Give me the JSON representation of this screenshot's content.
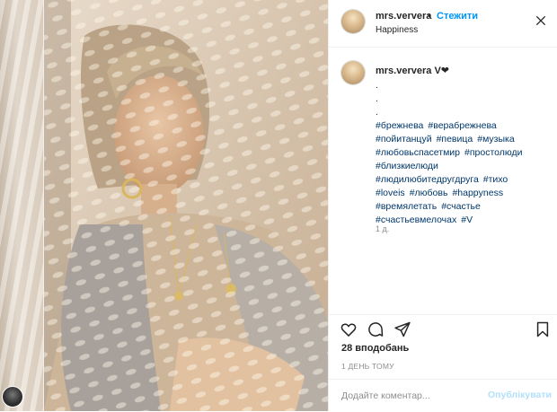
{
  "header": {
    "username": "mrs.ververa",
    "separator": "•",
    "follow_label": "Стежити",
    "location": "Happiness"
  },
  "caption": {
    "username": "mrs.ververa",
    "username_suffix": " V❤",
    "dots": [
      ".",
      ".",
      "."
    ],
    "hashtags": [
      "#брежнева",
      "#верабрежнева",
      "#пойитанцуй",
      "#певица",
      "#музыка",
      "#любовьспасетмир",
      "#простолюди",
      "#близкиелюди",
      "#людилюбитедругдруга",
      "#тихо",
      "#loveis",
      "#любовь",
      "#happyness",
      "#времялетать",
      "#счастье",
      "#счастьевмелочах",
      "#V"
    ],
    "time": "1 д."
  },
  "actions": {
    "icons": [
      "heart-icon",
      "comment-icon",
      "share-icon",
      "bookmark-icon"
    ]
  },
  "likes": "28 вподобань",
  "post_time": "1 ДЕНЬ ТОМУ",
  "comment": {
    "placeholder": "Додайте коментар...",
    "value": "",
    "publish_label": "Опублікувати"
  },
  "colors": {
    "accent": "#0095f6",
    "hashtag": "#00376b",
    "muted": "#8e8e8e",
    "publish_disabled": "#b2dffc"
  }
}
